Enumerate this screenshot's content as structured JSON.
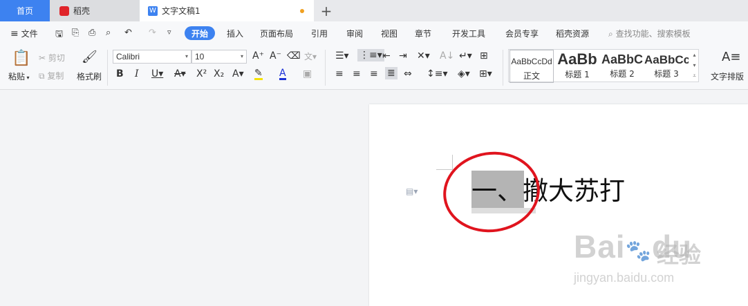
{
  "tabs": {
    "home": "首页",
    "daoke": "稻壳",
    "document": "文字文稿1",
    "add": "+"
  },
  "menu": {
    "file": "文件",
    "items": [
      "开始",
      "插入",
      "页面布局",
      "引用",
      "审阅",
      "视图",
      "章节",
      "开发工具",
      "会员专享",
      "稻壳资源"
    ],
    "search_placeholder": "查找功能、搜索模板"
  },
  "ribbon": {
    "paste": "粘贴",
    "cut": "剪切",
    "copy": "复制",
    "format_painter": "格式刷",
    "font_name": "Calibri",
    "font_size": "10",
    "styles": [
      {
        "sample": "AaBbCcDd",
        "name": "正文"
      },
      {
        "sample": "AaBb",
        "name": "标题 1"
      },
      {
        "sample": "AaBbC",
        "name": "标题 2"
      },
      {
        "sample": "AaBbCc",
        "name": "标题 3"
      }
    ],
    "text_layout": "文字排版"
  },
  "document": {
    "heading": "一、撤大苏打"
  },
  "watermark": {
    "brand": "Bai",
    "brand2": "du",
    "cn": "经验",
    "url": "jingyan.baidu.com"
  },
  "colors": {
    "accent": "#3d82f0",
    "annotation": "#e0141e",
    "selection": "#b4b4b4"
  }
}
